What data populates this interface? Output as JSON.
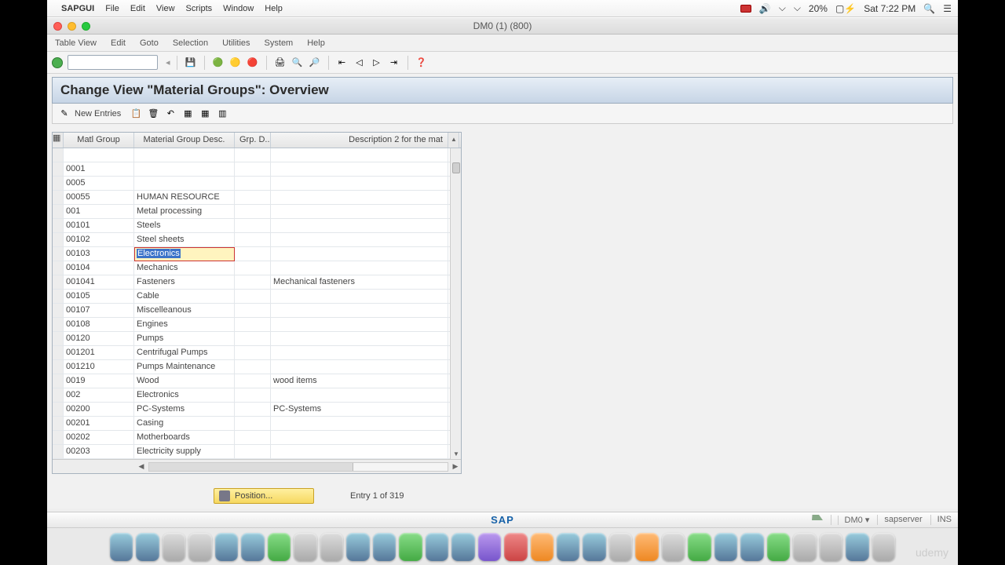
{
  "mac_menu": {
    "app": "SAPGUI",
    "items": [
      "File",
      "Edit",
      "View",
      "Scripts",
      "Window",
      "Help"
    ],
    "battery": "20%",
    "clock": "Sat 7:22 PM"
  },
  "window_title": "DM0 (1) (800)",
  "sap_menu": [
    "Table View",
    "Edit",
    "Goto",
    "Selection",
    "Utilities",
    "System",
    "Help"
  ],
  "page_title": "Change View \"Material Groups\": Overview",
  "action_bar": {
    "new_entries": "New Entries"
  },
  "columns": {
    "matl_group": "Matl Group",
    "desc": "Material Group Desc.",
    "grp_d": "Grp. D...",
    "desc2": "Description 2 for the mat"
  },
  "rows": [
    {
      "mg": "",
      "desc": "",
      "d2": ""
    },
    {
      "mg": "0001",
      "desc": "",
      "d2": ""
    },
    {
      "mg": "0005",
      "desc": "",
      "d2": ""
    },
    {
      "mg": "00055",
      "desc": "HUMAN RESOURCE",
      "d2": ""
    },
    {
      "mg": "001",
      "desc": "Metal processing",
      "d2": ""
    },
    {
      "mg": "00101",
      "desc": "Steels",
      "d2": ""
    },
    {
      "mg": "00102",
      "desc": "Steel sheets",
      "d2": ""
    },
    {
      "mg": "00103",
      "desc": "Electronics",
      "d2": "",
      "editing": true
    },
    {
      "mg": "00104",
      "desc": "Mechanics",
      "d2": ""
    },
    {
      "mg": "001041",
      "desc": "Fasteners",
      "d2": "Mechanical fasteners"
    },
    {
      "mg": "00105",
      "desc": "Cable",
      "d2": ""
    },
    {
      "mg": "00107",
      "desc": "Miscelleanous",
      "d2": ""
    },
    {
      "mg": "00108",
      "desc": "Engines",
      "d2": ""
    },
    {
      "mg": "00120",
      "desc": "Pumps",
      "d2": ""
    },
    {
      "mg": "001201",
      "desc": "Centrifugal Pumps",
      "d2": ""
    },
    {
      "mg": "001210",
      "desc": "Pumps Maintenance",
      "d2": ""
    },
    {
      "mg": "0019",
      "desc": "Wood",
      "d2": "wood items"
    },
    {
      "mg": "002",
      "desc": "Electronics",
      "d2": ""
    },
    {
      "mg": "00200",
      "desc": "PC-Systems",
      "d2": "PC-Systems"
    },
    {
      "mg": "00201",
      "desc": "Casing",
      "d2": ""
    },
    {
      "mg": "00202",
      "desc": "Motherboards",
      "d2": ""
    },
    {
      "mg": "00203",
      "desc": "Electricity supply",
      "d2": ""
    }
  ],
  "position_button": "Position...",
  "entry_counter": "Entry 1 of 319",
  "status": {
    "logo": "SAP",
    "system": "DM0",
    "server": "sapserver",
    "mode": "INS"
  },
  "watermark": "udemy"
}
